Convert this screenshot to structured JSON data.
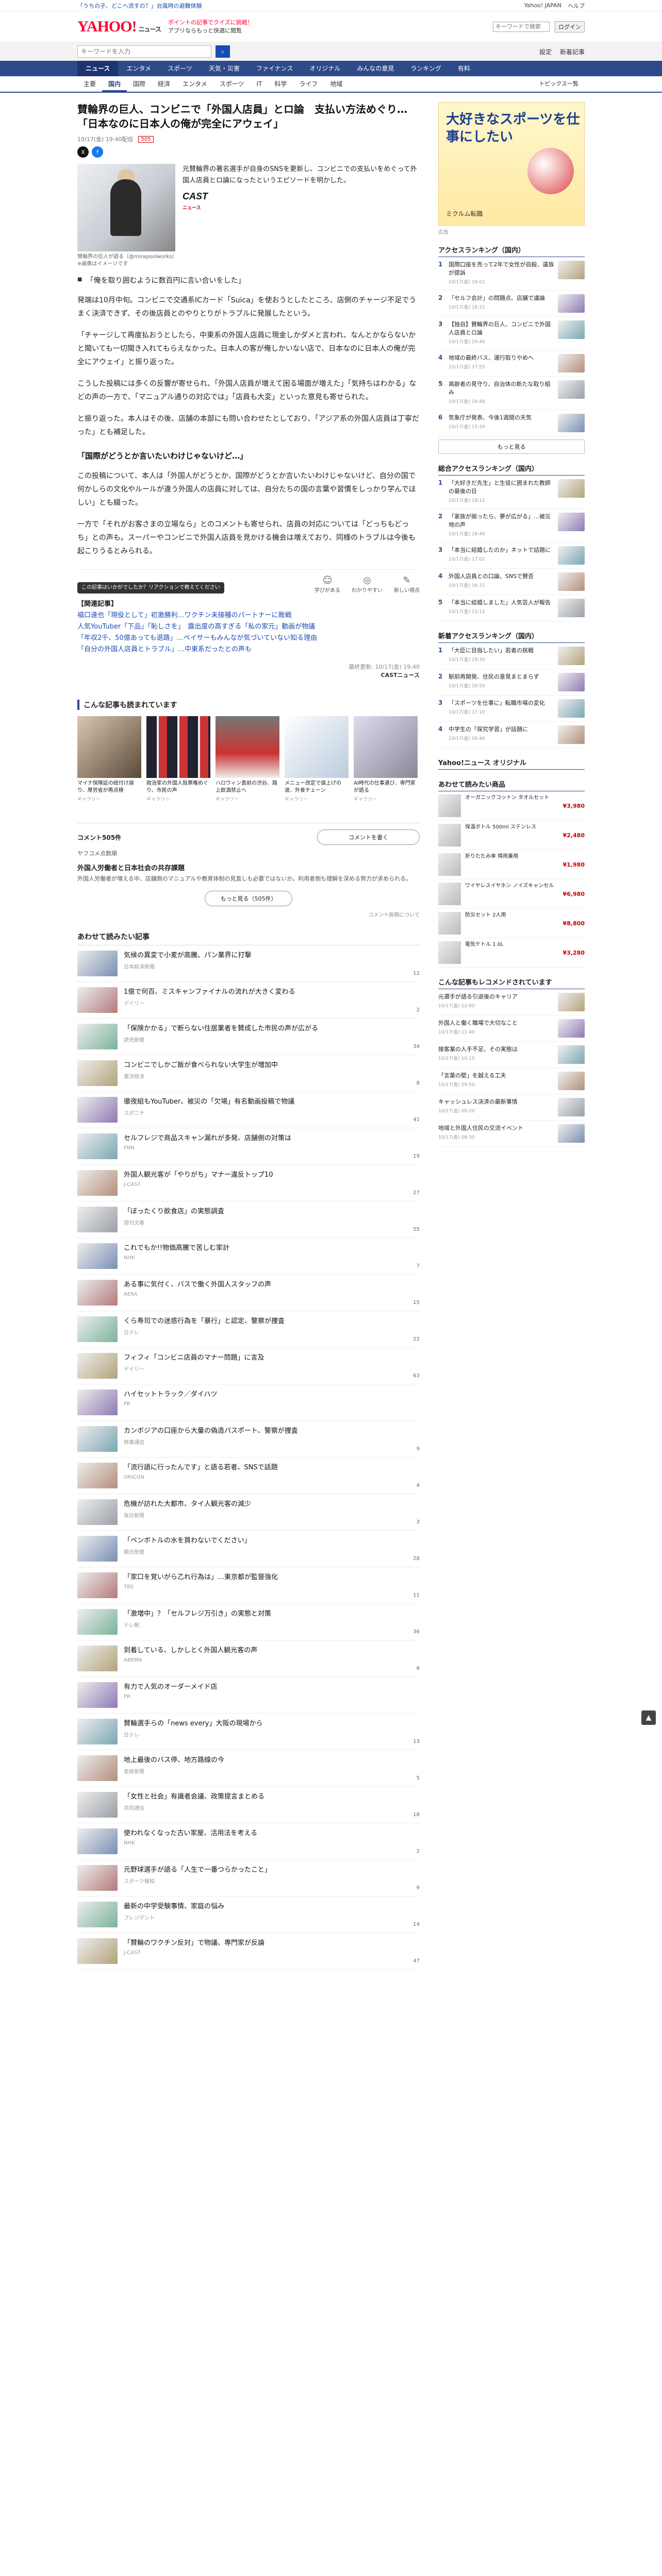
{
  "topstrip": {
    "promo": "「うちの子、どこへ流すの？」台風時の避難体験",
    "right_links": [
      "Yahoo! JAPAN",
      "ヘルプ"
    ]
  },
  "header": {
    "logo": "YAHOO!",
    "service": "ニュース",
    "promo1": "ポイントの記事でクイズに挑戦！",
    "promo2": "アプリならもっと快適に閲覧",
    "login": "ログイン",
    "search_placeholder": "キーワードで検索"
  },
  "search": {
    "placeholder": "キーワードを入力",
    "right": [
      "設定",
      "新着記事"
    ]
  },
  "nav1": [
    "ニュース",
    "エンタメ",
    "スポーツ",
    "天気・災害",
    "ファイナンス",
    "オリジナル",
    "みんなの意見",
    "ランキング",
    "有料"
  ],
  "nav2": [
    "主要",
    "国内",
    "国際",
    "経済",
    "エンタメ",
    "スポーツ",
    "IT",
    "科学",
    "ライフ",
    "地域"
  ],
  "nav2_more": "トピックス一覧",
  "article": {
    "title": "賛輪界の巨人、コンビニで「外国人店員」とロ論　支払い方法めぐり…「日本なのに日本人の俺が完全にアウェイ」",
    "date": "10/17(金) 19:40配信",
    "comment_badge": "505",
    "hero_caption": "賛輪界の巨人が語る（@mirapoolworks）※画像はイメージです",
    "hero_text": "元賛輪界の著名選手が自身のSNSを更新し、コンビニでの支払いをめぐって外国人店員とロ論になったというエピソードを明かした。",
    "source_name": "CAST",
    "source_sub": "ニュース",
    "bullet": "「俺を取り囲むように数百円に言い合いをした」",
    "paragraphs": [
      "発端は10月中旬。コンビニで交通系ICカード「Suica」を使おうとしたところ、店側のチャージ不足でうまく決済できず、その後店員とのやりとりがトラブルに発展したという。",
      "「チャージして再度払おうとしたら、中東系の外国人店員に現金しかダメと言われ、なんとかならないかと聞いても一切聞き入れてもらえなかった。日本人の客が俺しかいない店で、日本なのに日本人の俺が完全にアウェイ」と振り返った。",
      "こうした投稿には多くの反響が寄せられ、「外国人店員が増えて困る場面が増えた」「気持ちはわかる」などの声の一方で、「マニュアル通りの対応では」「店員も大変」といった意見も寄せられた。",
      "と振り返った。本人はその後、店舗の本部にも問い合わせたとしており、「アジア系の外国人店員は丁寧だった」とも補足した。"
    ],
    "subheading": "「国際がどうとか言いたいわけじゃないけど…」",
    "paragraphs2": [
      "この投稿について、本人は「外国人がどうとか、国際がどうとか言いたいわけじゃないけど、自分の国で何かしらの文化やルールが違う外国人の店員に対しては、自分たちの国の言葉や習慣をしっかり学んでほしい」とも綴った。",
      "一方で「それがお客さまの立場なら」とのコメントも寄せられ、店員の対応については「どっちもどっち」との声も。スーパーやコンビニで外国人店員を見かける機会は増えており、同様のトラブルは今後も起こりうるとみられる。"
    ],
    "tip": "この記事はいかがでしたか？リアクションで教えてください",
    "reactions": [
      {
        "icon": "☺",
        "label": "学びがある"
      },
      {
        "icon": "◎",
        "label": "わかりやすい"
      },
      {
        "icon": "✎",
        "label": "新しい視点"
      }
    ],
    "related_head": "【関連記事】",
    "related_links": [
      "福口達也「現役として」初激勝利…ワクチン未接種のパートナーに敗戦",
      "人気YouTuber「下品」「恥しさを」　露出度の高すぎる「私の家元」動画が物議",
      "「年収2千、50億あっても退路」…ペイサーもみんなが気づいていない知る理由",
      "「自分の外国人店員とトラブル」…中東系だったとの声も"
    ],
    "footer_source": "最終更新: 10/17(金) 19:40",
    "footer_name": "CASTニュース"
  },
  "recommend": {
    "title": "こんな記事も読まれています",
    "cards": [
      {
        "t": "マイナ保険証の紐付け誤り、厚労省が再点検",
        "s": "ギャラリー"
      },
      {
        "t": "政治家の外国人投票権めぐり、市民の声",
        "s": "ギャラリー"
      },
      {
        "t": "ハロウィン直前の渋谷、路上飲酒禁止へ",
        "s": "ギャラリー"
      },
      {
        "t": "メニュー改定で値上げの波、外食チェーン",
        "s": "ギャラリー"
      },
      {
        "t": "AI時代の仕事選び、専門家が語る",
        "s": "ギャラリー"
      }
    ]
  },
  "comments": {
    "count": "コメント505件",
    "write": "コメントを書く",
    "sort": "ヤフコメ点数順",
    "top_title": "外国人労働者と日本社会の共存課題",
    "top_body": "外国人労働者が増える中、店舗側のマニュアルや教育体制の見直しも必要ではないか。利用者側も理解を深める努力が求められる。",
    "more": "もっと見る（505件）",
    "footer": "コメント投稿について"
  },
  "more_list": {
    "title": "あわせて読みたい記事",
    "items": [
      {
        "t": "気候の異変で小麦が高騰、パン業界に打撃",
        "s": "日本経済新聞",
        "c": "12"
      },
      {
        "t": "1億で何百、ミスキャンファイナルの流れが大きく変わる",
        "s": "デイリー",
        "c": "2"
      },
      {
        "t": "「保険かかる」で断らない住居業者を賛成した市民の声が広がる",
        "s": "読売新聞",
        "c": "34"
      },
      {
        "t": "コンビニでしかご飯が食べられない大学生が増加中",
        "s": "東洋経済",
        "c": "8"
      },
      {
        "t": "徹夜組もYouTuber、被災の「欠場」有名動画投稿で物議",
        "s": "スポニチ",
        "c": "41"
      },
      {
        "t": "セルフレジで商品スキャン漏れが多発、店舗側の対策は",
        "s": "FNN",
        "c": "19"
      },
      {
        "t": "外国人観光客が「やりがち」マナー違反トップ10",
        "s": "J-CAST",
        "c": "27"
      },
      {
        "t": "「ぼったくり飲食店」の実態調査",
        "s": "週刊文春",
        "c": "55"
      },
      {
        "t": "これでもか!!物価高騰で苦しむ家計",
        "s": "NHK",
        "c": "7"
      },
      {
        "t": "ある事に気付く、バスで働く外国人スタッフの声",
        "s": "AERA",
        "c": "15"
      },
      {
        "t": "くら寿司での迷惑行為を「暴行」と認定、警察が捜査",
        "s": "日テレ",
        "c": "22"
      },
      {
        "t": "フィフィ「コンビニ店員のマナー問題」に言及",
        "s": "デイリー",
        "c": "63"
      },
      {
        "t": "ハイセットトラック／ダイハツ",
        "s": "PR",
        "c": ""
      },
      {
        "t": "カンボジアの口座から大量の偽造パスポート、警察が捜査",
        "s": "時事通信",
        "c": "9"
      },
      {
        "t": "「流行語に行ったんです」と語る若者、SNSで話題",
        "s": "ORICON",
        "c": "4"
      },
      {
        "t": "危機が訪れた大都市、タイ人観光客の減少",
        "s": "毎日新聞",
        "c": "3"
      },
      {
        "t": "「ペンボトルの水を買わないでください」",
        "s": "朝日新聞",
        "c": "28"
      },
      {
        "t": "「家口を覚いがら乙れ行為は」…東京都が監督強化",
        "s": "TBS",
        "c": "11"
      },
      {
        "t": "「激増中」？「セルフレジ万引き」の実態と対策",
        "s": "テレ朝",
        "c": "36"
      },
      {
        "t": "到着している、しかしとく外国人観光客の声",
        "s": "ABEMA",
        "c": "6"
      },
      {
        "t": "有力で人気のオーダーメイド店",
        "s": "PR",
        "c": ""
      },
      {
        "t": "賛輪選手らの「news every」大阪の現場から",
        "s": "日テレ",
        "c": "13"
      },
      {
        "t": "地上最後のバス停、地方路線の今",
        "s": "産経新聞",
        "c": "5"
      },
      {
        "t": "「女性と社会」有識者会議、政策提言まとめる",
        "s": "共同通信",
        "c": "18"
      },
      {
        "t": "使われなくなった古い家屋、活用法を考える",
        "s": "NHK",
        "c": "2"
      },
      {
        "t": "元野球選手が語る「人生で一番つらかったこと」",
        "s": "スポーツ報知",
        "c": "9"
      },
      {
        "t": "最新の中学受験事情、家庭の悩み",
        "s": "プレジデント",
        "c": "14"
      },
      {
        "t": "「賛輪のワクチン反対」で物議、専門家が反論",
        "s": "J-CAST",
        "c": "47"
      }
    ]
  },
  "sidebar": {
    "ad_text": "大好きなスポーツを仕事にしたい",
    "ad_sub": "ミクルム転職",
    "ad_caption": "広告",
    "access_title": "アクセスランキング（国内）",
    "access": [
      {
        "t": "国際口座を売って2年で女性が自殺、遺族が提訴",
        "s": "10/17(金) 19:01"
      },
      {
        "t": "「セルフ会計」の問題点、店舗で議論",
        "s": "10/17(金) 18:22"
      },
      {
        "t": "【独自】賛輪界の巨人、コンビニで外国人店員とロ論",
        "s": "10/17(金) 19:40"
      },
      {
        "t": "地域の最終バス、運行取りやめへ",
        "s": "10/17(金) 17:55"
      },
      {
        "t": "高齢者の見守り、自治体の新たな取り組み",
        "s": "10/17(金) 16:48"
      },
      {
        "t": "気象庁が発表、今後1週間の天気",
        "s": "10/17(金) 15:30"
      }
    ],
    "access_more": "もっと見る",
    "ranking_title": "総合アクセスランキング（国内）",
    "ranking": [
      {
        "t": "「大好きだ先生」と生徒に囲まれた教師の最後の日",
        "s": "10/17(金) 19:11"
      },
      {
        "t": "「家族が揃ったら、夢が広がる」…被災地の声",
        "s": "10/17(金) 18:40"
      },
      {
        "t": "「本当に結婚したのか」ネットで話題に",
        "s": "10/17(金) 17:02"
      },
      {
        "t": "外国人店員との口論、SNSで賛否",
        "s": "10/17(金) 16:31"
      },
      {
        "t": "「本当に結婚しました」人気芸人が報告",
        "s": "10/17(金) 15:12"
      }
    ],
    "cheer_title": "新着アクセスランキング（国内）",
    "cheer": [
      {
        "t": "「大臣に目指したい」若者の挑戦",
        "s": "10/17(金) 19:30"
      },
      {
        "t": "駅前再開発、住民の意見まとまらず",
        "s": "10/17(金) 18:50"
      },
      {
        "t": "「スポーツを仕事に」転職市場の変化",
        "s": "10/17(金) 17:10"
      },
      {
        "t": "中学生の「探究学習」が話題に",
        "s": "10/17(金) 16:40"
      }
    ],
    "original_title": "Yahoo!ニュース オリジナル",
    "products_title": "あわせて読みたい商品",
    "products": [
      {
        "t": "オーガニックコットン タオルセット",
        "p": "¥3,980"
      },
      {
        "t": "保温ボトル 500ml ステンレス",
        "p": "¥2,480"
      },
      {
        "t": "折りたたみ傘 晴雨兼用",
        "p": "¥1,980"
      },
      {
        "t": "ワイヤレスイヤホン ノイズキャンセル",
        "p": "¥6,980"
      },
      {
        "t": "防災セット 2人用",
        "p": "¥8,800"
      },
      {
        "t": "電気ケトル 1.0L",
        "p": "¥3,280"
      }
    ],
    "people_title": "こんな記事もレコメンドされています",
    "people": [
      {
        "t": "元選手が語る引退後のキャリア",
        "s": "10/17(金) 12:00"
      },
      {
        "t": "外国人と働く職場で大切なこと",
        "s": "10/17(金) 11:40"
      },
      {
        "t": "接客業の人手不足、その実態は",
        "s": "10/17(金) 10:15"
      },
      {
        "t": "「言葉の壁」を越える工夫",
        "s": "10/17(金) 09:50"
      },
      {
        "t": "キャッシュレス決済の最新事情",
        "s": "10/17(金) 09:20"
      },
      {
        "t": "地域と外国人住民の交流イベント",
        "s": "10/17(金) 08:30"
      }
    ]
  },
  "pagetop": "▲"
}
